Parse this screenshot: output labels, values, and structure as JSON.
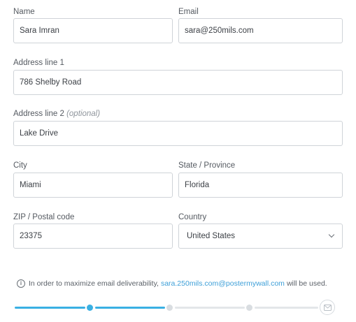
{
  "form": {
    "name": {
      "label": "Name",
      "value": "Sara Imran"
    },
    "email": {
      "label": "Email",
      "value": "sara@250mils.com"
    },
    "address1": {
      "label": "Address line 1",
      "value": "786 Shelby Road"
    },
    "address2": {
      "label": "Address line 2",
      "optional_hint": "(optional)",
      "value": "Lake Drive"
    },
    "city": {
      "label": "City",
      "value": "Miami"
    },
    "state": {
      "label": "State / Province",
      "value": "Florida"
    },
    "zip": {
      "label": "ZIP / Postal code",
      "value": "23375"
    },
    "country": {
      "label": "Country",
      "value": "United States"
    }
  },
  "notice": {
    "icon": "info-icon",
    "prefix": "In order to maximize email deliverability,",
    "email": "sara.250mils.com@postermywall.com",
    "suffix": "will be used."
  },
  "progress": {
    "steps_total": 5,
    "steps_completed": 2,
    "final_step_icon": "mail-icon",
    "accent_color": "#3ab0e3"
  }
}
